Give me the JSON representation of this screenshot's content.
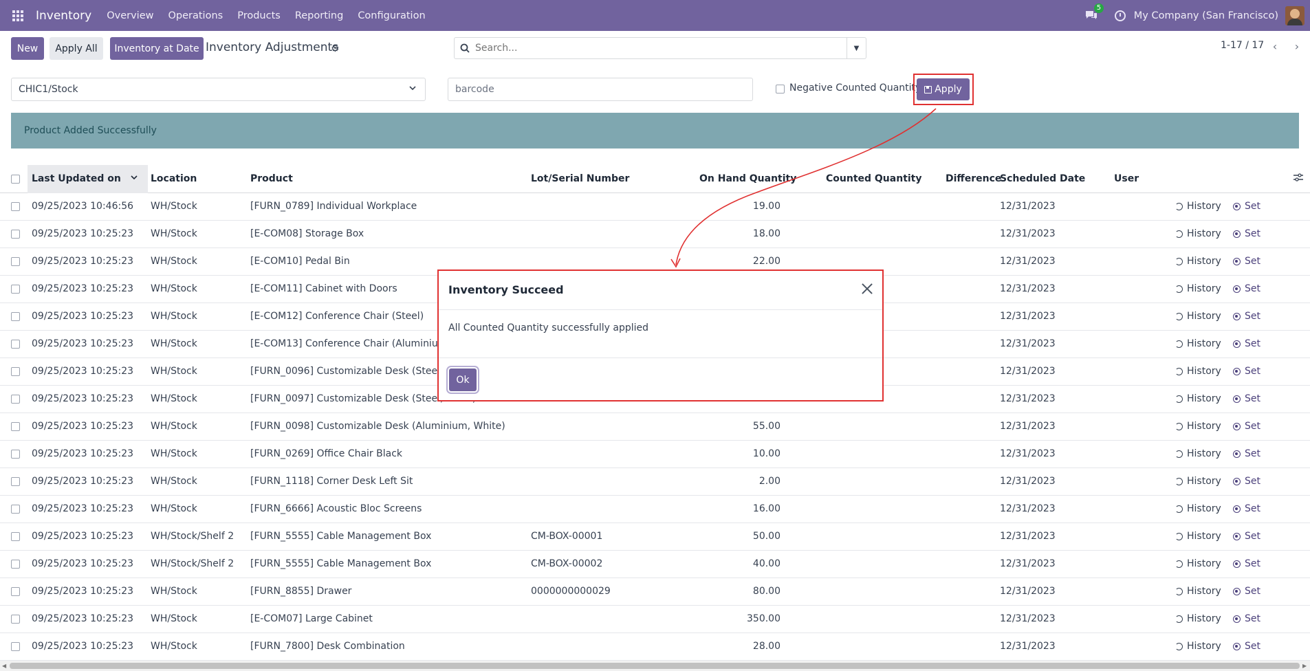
{
  "navbar": {
    "app_name": "Inventory",
    "menu": [
      "Overview",
      "Operations",
      "Products",
      "Reporting",
      "Configuration"
    ],
    "chat_badge": "5",
    "company": "My Company (San Francisco)"
  },
  "control_panel": {
    "new_label": "New",
    "apply_all_label": "Apply All",
    "inventory_at_date_label": "Inventory at Date",
    "title": "Inventory Adjustments",
    "search_placeholder": "Search...",
    "pager": "1-17 / 17"
  },
  "filters": {
    "location_value": "CHIC1/Stock",
    "barcode_placeholder": "barcode",
    "negative_label": "Negative Counted Quantity?",
    "apply_label": "Apply"
  },
  "alert": {
    "message": "Product Added Successfully"
  },
  "table": {
    "headers": {
      "last_updated": "Last Updated on",
      "location": "Location",
      "product": "Product",
      "lot": "Lot/Serial Number",
      "on_hand": "On Hand Quantity",
      "counted": "Counted Quantity",
      "difference": "Difference",
      "scheduled": "Scheduled Date",
      "user": "User"
    },
    "history_label": "History",
    "set_label": "Set",
    "rows": [
      {
        "date": "09/25/2023 10:46:56",
        "location": "WH/Stock",
        "product": "[FURN_0789] Individual Workplace",
        "lot": "",
        "on_hand": "19.00",
        "scheduled": "12/31/2023"
      },
      {
        "date": "09/25/2023 10:25:23",
        "location": "WH/Stock",
        "product": "[E-COM08] Storage Box",
        "lot": "",
        "on_hand": "18.00",
        "scheduled": "12/31/2023"
      },
      {
        "date": "09/25/2023 10:25:23",
        "location": "WH/Stock",
        "product": "[E-COM10] Pedal Bin",
        "lot": "",
        "on_hand": "22.00",
        "scheduled": "12/31/2023"
      },
      {
        "date": "09/25/2023 10:25:23",
        "location": "WH/Stock",
        "product": "[E-COM11] Cabinet with Doors",
        "lot": "",
        "on_hand": "",
        "scheduled": "12/31/2023"
      },
      {
        "date": "09/25/2023 10:25:23",
        "location": "WH/Stock",
        "product": "[E-COM12] Conference Chair (Steel)",
        "lot": "",
        "on_hand": "",
        "scheduled": "12/31/2023"
      },
      {
        "date": "09/25/2023 10:25:23",
        "location": "WH/Stock",
        "product": "[E-COM13] Conference Chair (Aluminium)",
        "lot": "",
        "on_hand": "",
        "scheduled": "12/31/2023"
      },
      {
        "date": "09/25/2023 10:25:23",
        "location": "WH/Stock",
        "product": "[FURN_0096] Customizable Desk (Steel, Wh",
        "lot": "",
        "on_hand": "",
        "scheduled": "12/31/2023"
      },
      {
        "date": "09/25/2023 10:25:23",
        "location": "WH/Stock",
        "product": "[FURN_0097] Customizable Desk (Steel, Black)",
        "lot": "",
        "on_hand": "",
        "scheduled": "12/31/2023"
      },
      {
        "date": "09/25/2023 10:25:23",
        "location": "WH/Stock",
        "product": "[FURN_0098] Customizable Desk (Aluminium, White)",
        "lot": "",
        "on_hand": "55.00",
        "scheduled": "12/31/2023"
      },
      {
        "date": "09/25/2023 10:25:23",
        "location": "WH/Stock",
        "product": "[FURN_0269] Office Chair Black",
        "lot": "",
        "on_hand": "10.00",
        "scheduled": "12/31/2023"
      },
      {
        "date": "09/25/2023 10:25:23",
        "location": "WH/Stock",
        "product": "[FURN_1118] Corner Desk Left Sit",
        "lot": "",
        "on_hand": "2.00",
        "scheduled": "12/31/2023"
      },
      {
        "date": "09/25/2023 10:25:23",
        "location": "WH/Stock",
        "product": "[FURN_6666] Acoustic Bloc Screens",
        "lot": "",
        "on_hand": "16.00",
        "scheduled": "12/31/2023"
      },
      {
        "date": "09/25/2023 10:25:23",
        "location": "WH/Stock/Shelf 2",
        "product": "[FURN_5555] Cable Management Box",
        "lot": "CM-BOX-00001",
        "on_hand": "50.00",
        "scheduled": "12/31/2023"
      },
      {
        "date": "09/25/2023 10:25:23",
        "location": "WH/Stock/Shelf 2",
        "product": "[FURN_5555] Cable Management Box",
        "lot": "CM-BOX-00002",
        "on_hand": "40.00",
        "scheduled": "12/31/2023"
      },
      {
        "date": "09/25/2023 10:25:23",
        "location": "WH/Stock",
        "product": "[FURN_8855] Drawer",
        "lot": "0000000000029",
        "on_hand": "80.00",
        "scheduled": "12/31/2023"
      },
      {
        "date": "09/25/2023 10:25:23",
        "location": "WH/Stock",
        "product": "[E-COM07] Large Cabinet",
        "lot": "",
        "on_hand": "350.00",
        "scheduled": "12/31/2023"
      },
      {
        "date": "09/25/2023 10:25:23",
        "location": "WH/Stock",
        "product": "[FURN_7800] Desk Combination",
        "lot": "",
        "on_hand": "28.00",
        "scheduled": "12/31/2023"
      }
    ]
  },
  "modal": {
    "title": "Inventory Succeed",
    "body": "All Counted Quantity successfully applied",
    "ok_label": "Ok"
  },
  "colors": {
    "brand": "#71639e",
    "annotation_red": "#e03131",
    "alert_bg": "#7fa7b0"
  }
}
